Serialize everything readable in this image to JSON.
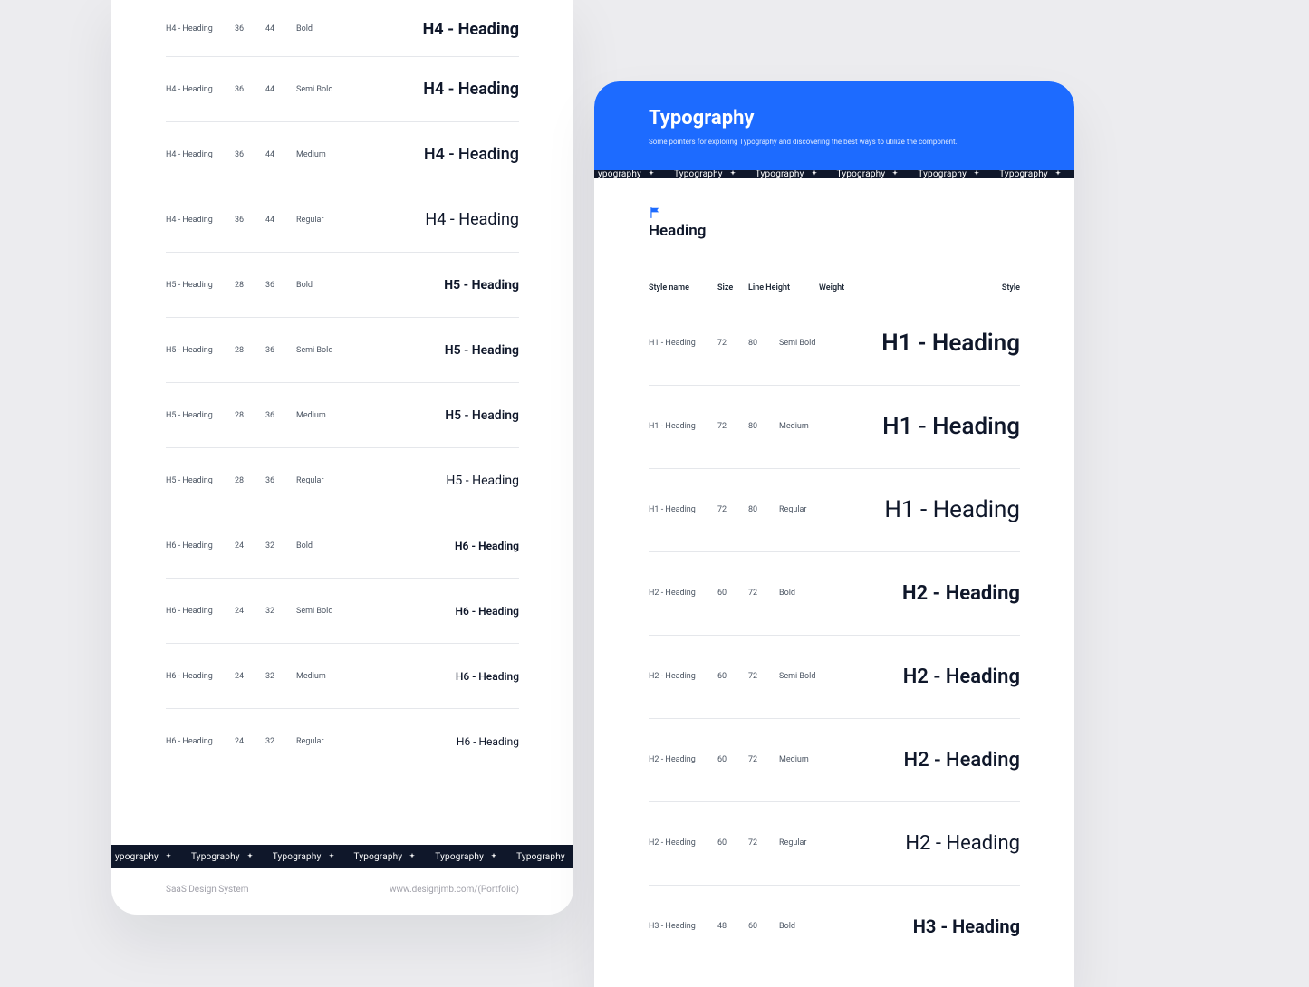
{
  "left": {
    "rows": [
      {
        "name": "H4 - Heading",
        "size": "36",
        "lh": "44",
        "weight": "Bold",
        "sample": "H4 - Heading",
        "sampleClass": "s-h4 w-bold"
      },
      {
        "name": "H4 - Heading",
        "size": "36",
        "lh": "44",
        "weight": "Semi Bold",
        "sample": "H4 - Heading",
        "sampleClass": "s-h4 w-semibold"
      },
      {
        "name": "H4 - Heading",
        "size": "36",
        "lh": "44",
        "weight": "Medium",
        "sample": "H4 - Heading",
        "sampleClass": "s-h4 w-medium"
      },
      {
        "name": "H4 - Heading",
        "size": "36",
        "lh": "44",
        "weight": "Regular",
        "sample": "H4 - Heading",
        "sampleClass": "s-h4 w-regular"
      },
      {
        "name": "H5 - Heading",
        "size": "28",
        "lh": "36",
        "weight": "Bold",
        "sample": "H5 - Heading",
        "sampleClass": "s-h5 w-bold"
      },
      {
        "name": "H5 - Heading",
        "size": "28",
        "lh": "36",
        "weight": "Semi Bold",
        "sample": "H5 - Heading",
        "sampleClass": "s-h5 w-semibold"
      },
      {
        "name": "H5 - Heading",
        "size": "28",
        "lh": "36",
        "weight": "Medium",
        "sample": "H5 - Heading",
        "sampleClass": "s-h5 w-medium"
      },
      {
        "name": "H5 - Heading",
        "size": "28",
        "lh": "36",
        "weight": "Regular",
        "sample": "H5 - Heading",
        "sampleClass": "s-h5 w-regular"
      },
      {
        "name": "H6 - Heading",
        "size": "24",
        "lh": "32",
        "weight": "Bold",
        "sample": "H6 - Heading",
        "sampleClass": "s-h6 w-bold"
      },
      {
        "name": "H6 - Heading",
        "size": "24",
        "lh": "32",
        "weight": "Semi Bold",
        "sample": "H6 - Heading",
        "sampleClass": "s-h6 w-semibold"
      },
      {
        "name": "H6 - Heading",
        "size": "24",
        "lh": "32",
        "weight": "Medium",
        "sample": "H6 - Heading",
        "sampleClass": "s-h6 w-medium"
      },
      {
        "name": "H6 - Heading",
        "size": "24",
        "lh": "32",
        "weight": "Regular",
        "sample": "H6 - Heading",
        "sampleClass": "s-h6 w-regular"
      }
    ],
    "footer": {
      "left": "SaaS Design System",
      "right": "www.designjmb.com/(Portfolio)"
    }
  },
  "right": {
    "hero": {
      "title": "Typography",
      "subtitle": "Some pointers for exploring Typography and discovering the best ways to utilize the component."
    },
    "section": {
      "title": "Heading"
    },
    "columns": {
      "name": "Style name",
      "size": "Size",
      "lh": "Line Height",
      "weight": "Weight",
      "style": "Style"
    },
    "rows": [
      {
        "name": "H1 - Heading",
        "size": "72",
        "lh": "80",
        "weight": "Semi Bold",
        "sample": "H1 - Heading",
        "sampleClass": "s-h1 w-semibold"
      },
      {
        "name": "H1 - Heading",
        "size": "72",
        "lh": "80",
        "weight": "Medium",
        "sample": "H1 - Heading",
        "sampleClass": "s-h1 w-medium"
      },
      {
        "name": "H1 - Heading",
        "size": "72",
        "lh": "80",
        "weight": "Regular",
        "sample": "H1 - Heading",
        "sampleClass": "s-h1 w-regular"
      },
      {
        "name": "H2 - Heading",
        "size": "60",
        "lh": "72",
        "weight": "Bold",
        "sample": "H2 - Heading",
        "sampleClass": "s-h2 w-bold"
      },
      {
        "name": "H2 - Heading",
        "size": "60",
        "lh": "72",
        "weight": "Semi Bold",
        "sample": "H2 - Heading",
        "sampleClass": "s-h2 w-semibold"
      },
      {
        "name": "H2 - Heading",
        "size": "60",
        "lh": "72",
        "weight": "Medium",
        "sample": "H2 - Heading",
        "sampleClass": "s-h2 w-medium"
      },
      {
        "name": "H2 - Heading",
        "size": "60",
        "lh": "72",
        "weight": "Regular",
        "sample": "H2 - Heading",
        "sampleClass": "s-h2 w-regular"
      },
      {
        "name": "H3 - Heading",
        "size": "48",
        "lh": "60",
        "weight": "Bold",
        "sample": "H3 - Heading",
        "sampleClass": "s-h3 w-bold"
      }
    ]
  },
  "marquee": {
    "text": "Typography"
  }
}
